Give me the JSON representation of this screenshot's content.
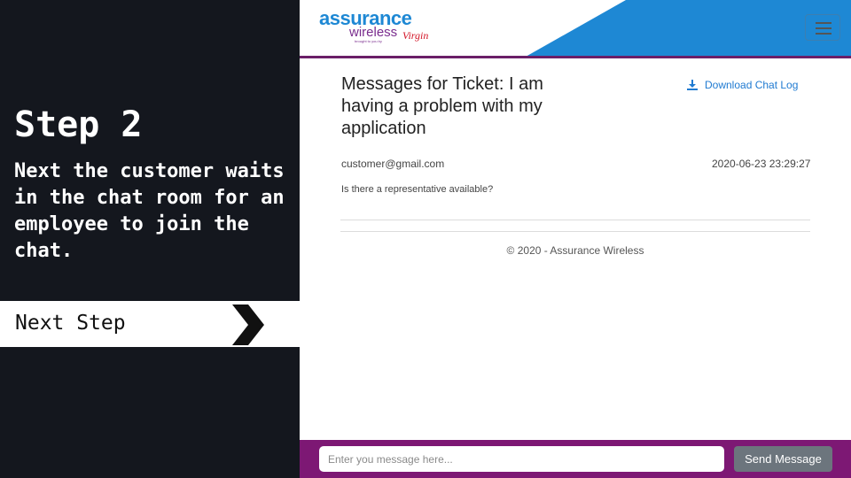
{
  "tutorial": {
    "step_title": "Step 2",
    "step_description": "Next the customer waits in the chat room for an employee to join the chat.",
    "next_step_label": "Next Step"
  },
  "navbar": {
    "logo_primary": "assurance",
    "logo_secondary": "wireless",
    "logo_tagline": "brought to you by",
    "logo_brand": "Virgin",
    "accent_color": "#1e88d4",
    "border_color": "#6b1f68"
  },
  "ticket": {
    "title": "Messages for Ticket: I am having a problem with my application",
    "download_label": "Download Chat Log"
  },
  "messages": [
    {
      "sender": "customer@gmail.com",
      "timestamp": "2020-06-23 23:29:27",
      "text": "Is there a representative available?"
    }
  ],
  "footer": {
    "text": "© 2020 - Assurance Wireless"
  },
  "composer": {
    "placeholder": "Enter you message here...",
    "value": "",
    "send_label": "Send Message",
    "bar_color": "#7d1874"
  }
}
